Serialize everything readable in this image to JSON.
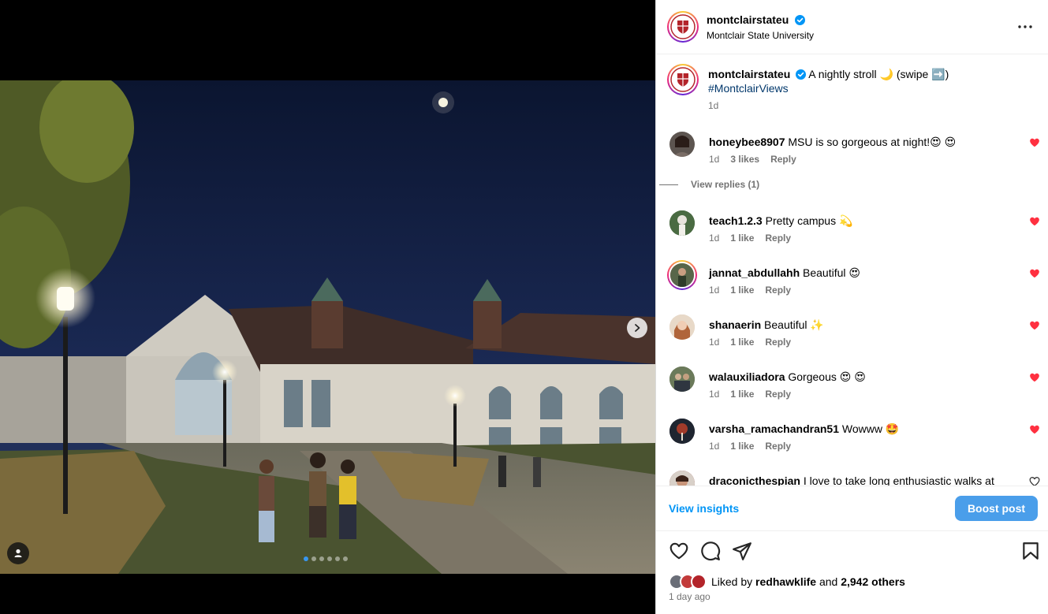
{
  "post": {
    "author": "montclairstateu",
    "author_full_name": "Montclair State University",
    "caption_text": "A nightly stroll 🌙 (swipe ➡️)",
    "hashtag": "#MontclairViews",
    "caption_time": "1d",
    "carousel": {
      "total": 6,
      "current": 1
    }
  },
  "comments": [
    {
      "user": "honeybee8907",
      "text": "MSU is so gorgeous at night!😍 😍",
      "time": "1d",
      "likes": "3 likes",
      "reply": "Reply",
      "liked": true,
      "view_replies": "View replies (1)"
    },
    {
      "user": "teach1.2.3",
      "text": "Pretty campus 💫",
      "time": "1d",
      "likes": "1 like",
      "reply": "Reply",
      "liked": true
    },
    {
      "user": "jannat_abdullahh",
      "text": "Beautiful 😍",
      "time": "1d",
      "likes": "1 like",
      "reply": "Reply",
      "liked": true
    },
    {
      "user": "shanaerin",
      "text": "Beautiful ✨",
      "time": "1d",
      "likes": "1 like",
      "reply": "Reply",
      "liked": true
    },
    {
      "user": "walauxiliadora",
      "text": "Gorgeous 😍 😍",
      "time": "1d",
      "likes": "1 like",
      "reply": "Reply",
      "liked": true
    },
    {
      "user": "varsha_ramachandran51",
      "text": "Wowww 🤩",
      "time": "1d",
      "likes": "1 like",
      "reply": "Reply",
      "liked": true
    },
    {
      "user": "draconicthespian",
      "text": "I love to take long enthusiastic walks at",
      "liked": false
    }
  ],
  "footer": {
    "view_insights": "View insights",
    "boost_post": "Boost post",
    "liked_by_prefix": "Liked by",
    "liked_by_user": "redhawklife",
    "liked_by_and": "and",
    "liked_by_others": "2,942 others",
    "post_age": "1 day ago"
  },
  "colors": {
    "link_blue": "#0095f6",
    "hashtag": "#00376b",
    "like_red": "#ff3040",
    "muted_text": "#737373",
    "boost_button": "#4a9eea"
  },
  "icons": [
    "verified-badge-icon",
    "more-options-icon",
    "next-arrow-icon",
    "user-tag-icon",
    "heart-icon",
    "comment-icon",
    "share-icon",
    "bookmark-icon"
  ]
}
